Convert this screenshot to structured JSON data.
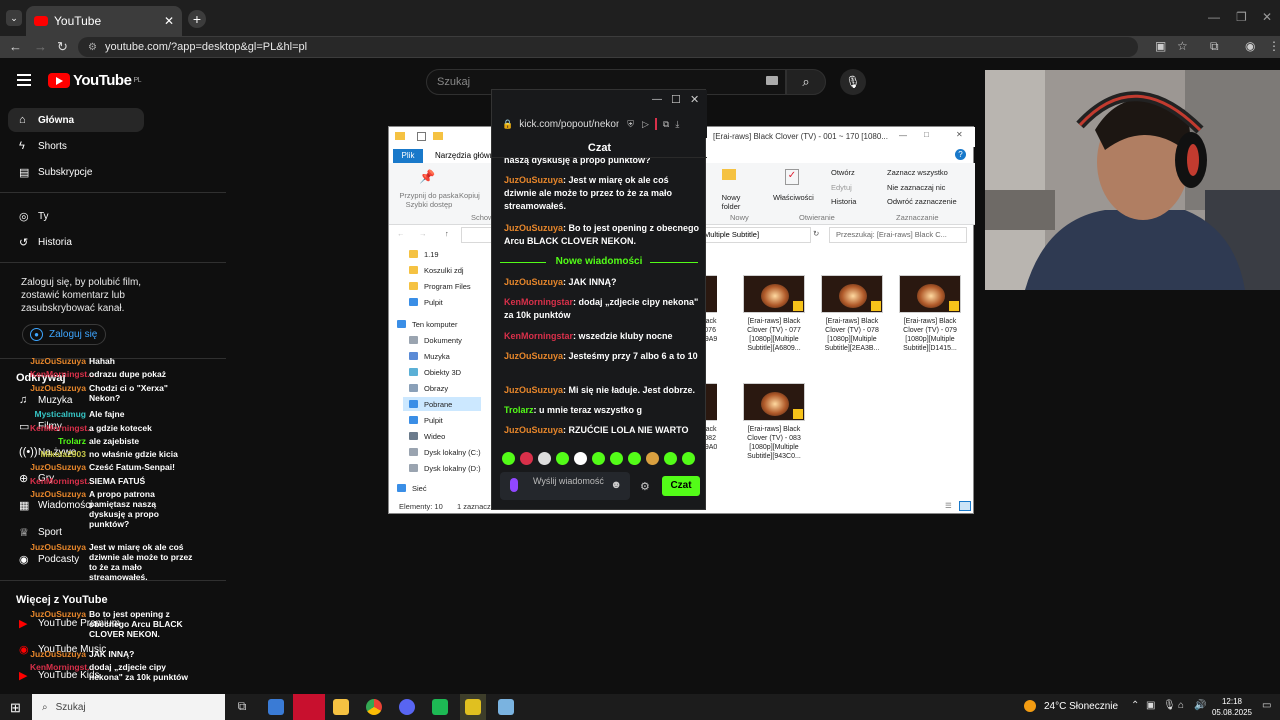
{
  "browser": {
    "tab_title": "YouTube",
    "url": "youtube.com/?app=desktop&gl=PL&hl=pl",
    "new_tab": "+",
    "tab_close": "✕"
  },
  "youtube": {
    "logo_text": "YouTube",
    "logo_region": "PL",
    "search_placeholder": "Szukaj",
    "sidebar": {
      "items": [
        {
          "label": "Główna",
          "icon": "home-icon"
        },
        {
          "label": "Shorts",
          "icon": "shorts-icon"
        },
        {
          "label": "Subskrypcje",
          "icon": "subscriptions-icon"
        },
        {
          "label": "Ty",
          "icon": "user-icon"
        },
        {
          "label": "Historia",
          "icon": "history-icon"
        }
      ],
      "signin_text": "Zaloguj się, by polubić film, zostawić komentarz lub zasubskrybować kanał.",
      "signin_button": "Zaloguj się",
      "explore_header": "Odkrywaj",
      "explore_items": [
        "Muzyka",
        "Filmy",
        "Na żywo",
        "Gry",
        "Wiadomości",
        "Sport",
        "Podcasty"
      ],
      "more_header": "Więcej z YouTube",
      "more_items": [
        "YouTube Premium",
        "YouTube Music",
        "YouTube Kids"
      ]
    }
  },
  "overlay_chat": [
    {
      "user": "JuzOuSuzuya",
      "msg": "Hahah",
      "color": "#e6862b"
    },
    {
      "user": "KenMorningst...",
      "msg": "odrazu dupe pokaż",
      "color": "#d9304a"
    },
    {
      "user": "JuzOuSuzuya",
      "msg": "Chodzi ci o \"Xerxa\" Nekon?",
      "color": "#e6862b"
    },
    {
      "user": "Mysticalmug",
      "msg": "Ale fajne",
      "color": "#36c5c5"
    },
    {
      "user": "KenMorningst...",
      "msg": "a gdzie kotecek",
      "color": "#d9304a"
    },
    {
      "user": "Trolarz",
      "msg": "ale zajebiste",
      "color": "#53fc18"
    },
    {
      "user": "Mikola2903",
      "msg": "no właśnie gdzie kicia",
      "color": "#c9c94a"
    },
    {
      "user": "JuzOuSuzuya",
      "msg": "Cześć Fatum-Senpai!",
      "color": "#e6862b"
    },
    {
      "user": "KenMorningst...",
      "msg": "SIEMA FATUŚ",
      "color": "#d9304a"
    },
    {
      "user": "JuzOuSuzuya",
      "msg": "A propo patrona pamiętasz naszą dyskusję a propo punktów?",
      "color": "#e6862b"
    },
    {
      "user": "JuzOuSuzuya",
      "msg": "Jest w miarę ok ale coś dziwnie ale może to przez to że za mało streamowałeś.",
      "color": "#e6862b"
    },
    {
      "user": "JuzOuSuzuya",
      "msg": "Bo to jest opening z obecnego Arcu BLACK CLOVER NEKON.",
      "color": "#e6862b"
    },
    {
      "user": "JuzOuSuzuya",
      "msg": "JAK INNĄ?",
      "color": "#e6862b"
    },
    {
      "user": "KenMorningst...",
      "msg": "dodaj „zdjecie cipy nekona\" za 10k punktów",
      "color": "#d9304a"
    },
    {
      "user": "KenMorningst...",
      "msg": "wszedzie kluby nocne",
      "color": "#d9304a"
    }
  ],
  "explorer": {
    "title": "[Erai-raws] Black Clover (TV) - 001 ~ 170 [1080...",
    "tab_file": "Plik",
    "tab_tools": "Narzędzia główne",
    "ribbon": {
      "pin": "Przypnij do paska Szybki dostęp",
      "copy": "Kopiuj",
      "clipboard_group": "Schowek",
      "new_folder": "Nowy folder",
      "new_group": "Nowy",
      "properties": "Właściwości",
      "open": "Otwórz",
      "edit": "Edytuj",
      "history": "Historia",
      "open_group": "Otwieranie",
      "select_all": "Zaznacz wszystko",
      "select_none": "Nie zaznaczaj nic",
      "invert": "Odwróć zaznaczenie",
      "select_group": "Zaznaczanie"
    },
    "address_tail": "Multiple Subtitle]",
    "search_placeholder": "Przeszukaj: [Erai-raws] Black C...",
    "nav": [
      {
        "label": "1.19",
        "color": "#f5c242"
      },
      {
        "label": "Koszulki zdj",
        "color": "#f5c242"
      },
      {
        "label": "Program Files",
        "color": "#f5c242"
      },
      {
        "label": "Pulpit",
        "color": "#3a8ee6"
      },
      {
        "label": "Ten komputer",
        "color": "#3a8ee6"
      },
      {
        "label": "Dokumenty",
        "color": "#9aa4b0"
      },
      {
        "label": "Muzyka",
        "color": "#5b8bd6"
      },
      {
        "label": "Obiekty 3D",
        "color": "#5bb0d6"
      },
      {
        "label": "Obrazy",
        "color": "#8aa0b8"
      },
      {
        "label": "Pobrane",
        "color": "#3a8ee6"
      },
      {
        "label": "Pulpit",
        "color": "#3a8ee6"
      },
      {
        "label": "Wideo",
        "color": "#6b7b8c"
      },
      {
        "label": "Dysk lokalny (C:)",
        "color": "#9aa4b0"
      },
      {
        "label": "Dysk lokalny (D:)",
        "color": "#9aa4b0"
      },
      {
        "label": "Sieć",
        "color": "#3a8ee6"
      }
    ],
    "files": [
      {
        "caption": "Black - 076 ...9A93..."
      },
      {
        "caption": "[Erai-raws] Black Clover (TV) - 077 [1080p][Multiple Subtitle][A6809..."
      },
      {
        "caption": "[Erai-raws] Black Clover (TV) - 078 [1080p][Multiple Subtitle][2EA3B..."
      },
      {
        "caption": "[Erai-raws] Black Clover (TV) - 079 [1080p][Multiple Subtitle][D1415..."
      },
      {
        "caption": "Black - 082 ...9A0..."
      },
      {
        "caption": "[Erai-raws] Black Clover (TV) - 083 [1080p][Multiple Subtitle][943C0..."
      }
    ],
    "status_items": "Elementy: 10",
    "status_selected": "1 zaznacz..."
  },
  "kick": {
    "url": "kick.com/popout/nekon",
    "header": "Czat",
    "partial_top": "naszą dyskusję a propo punktów?",
    "messages_before": [
      {
        "user": "JuzOuSuzuya",
        "msg": ": Jest w miarę ok ale coś dziwnie ale może to przez to że za mało streamowałeś.",
        "color": "#e6862b"
      },
      {
        "user": "JuzOuSuzuya",
        "msg": ": Bo to jest opening z obecnego Arcu BLACK CLOVER NEKON.",
        "color": "#e6862b"
      }
    ],
    "new_messages": "Nowe wiadomości",
    "messages_after": [
      {
        "user": "JuzOuSuzuya",
        "msg": ": JAK INNĄ?",
        "color": "#e6862b"
      },
      {
        "user": "KenMorningstar",
        "msg": ": dodaj „zdjecie cipy nekona\" za 10k punktów",
        "color": "#d9304a"
      },
      {
        "user": "KenMorningstar",
        "msg": ": wszedzie kluby nocne",
        "color": "#d9304a"
      },
      {
        "user": "JuzOuSuzuya",
        "msg": ": Jesteśmy przy 7 albo 6 a to 10",
        "color": "#e6862b"
      },
      {
        "user": "JuzOuSuzuya",
        "msg": ": Mi się nie ładuje. Jest dobrze.",
        "color": "#e6862b"
      },
      {
        "user": "Trolarz",
        "msg": ": u mnie teraz wszystko g",
        "color": "#53fc18"
      },
      {
        "user": "JuzOuSuzuya",
        "msg": ": RZUĆCIE LOLA NIE WARTO",
        "color": "#e6862b"
      }
    ],
    "input_placeholder": "Wyślij wiadomość",
    "send_button": "Czat",
    "accent": "#53fc18"
  },
  "taskbar": {
    "search": "Szukaj",
    "weather": "24°C  Słonecznie",
    "time": "12:18",
    "date": "05.08.2025"
  }
}
